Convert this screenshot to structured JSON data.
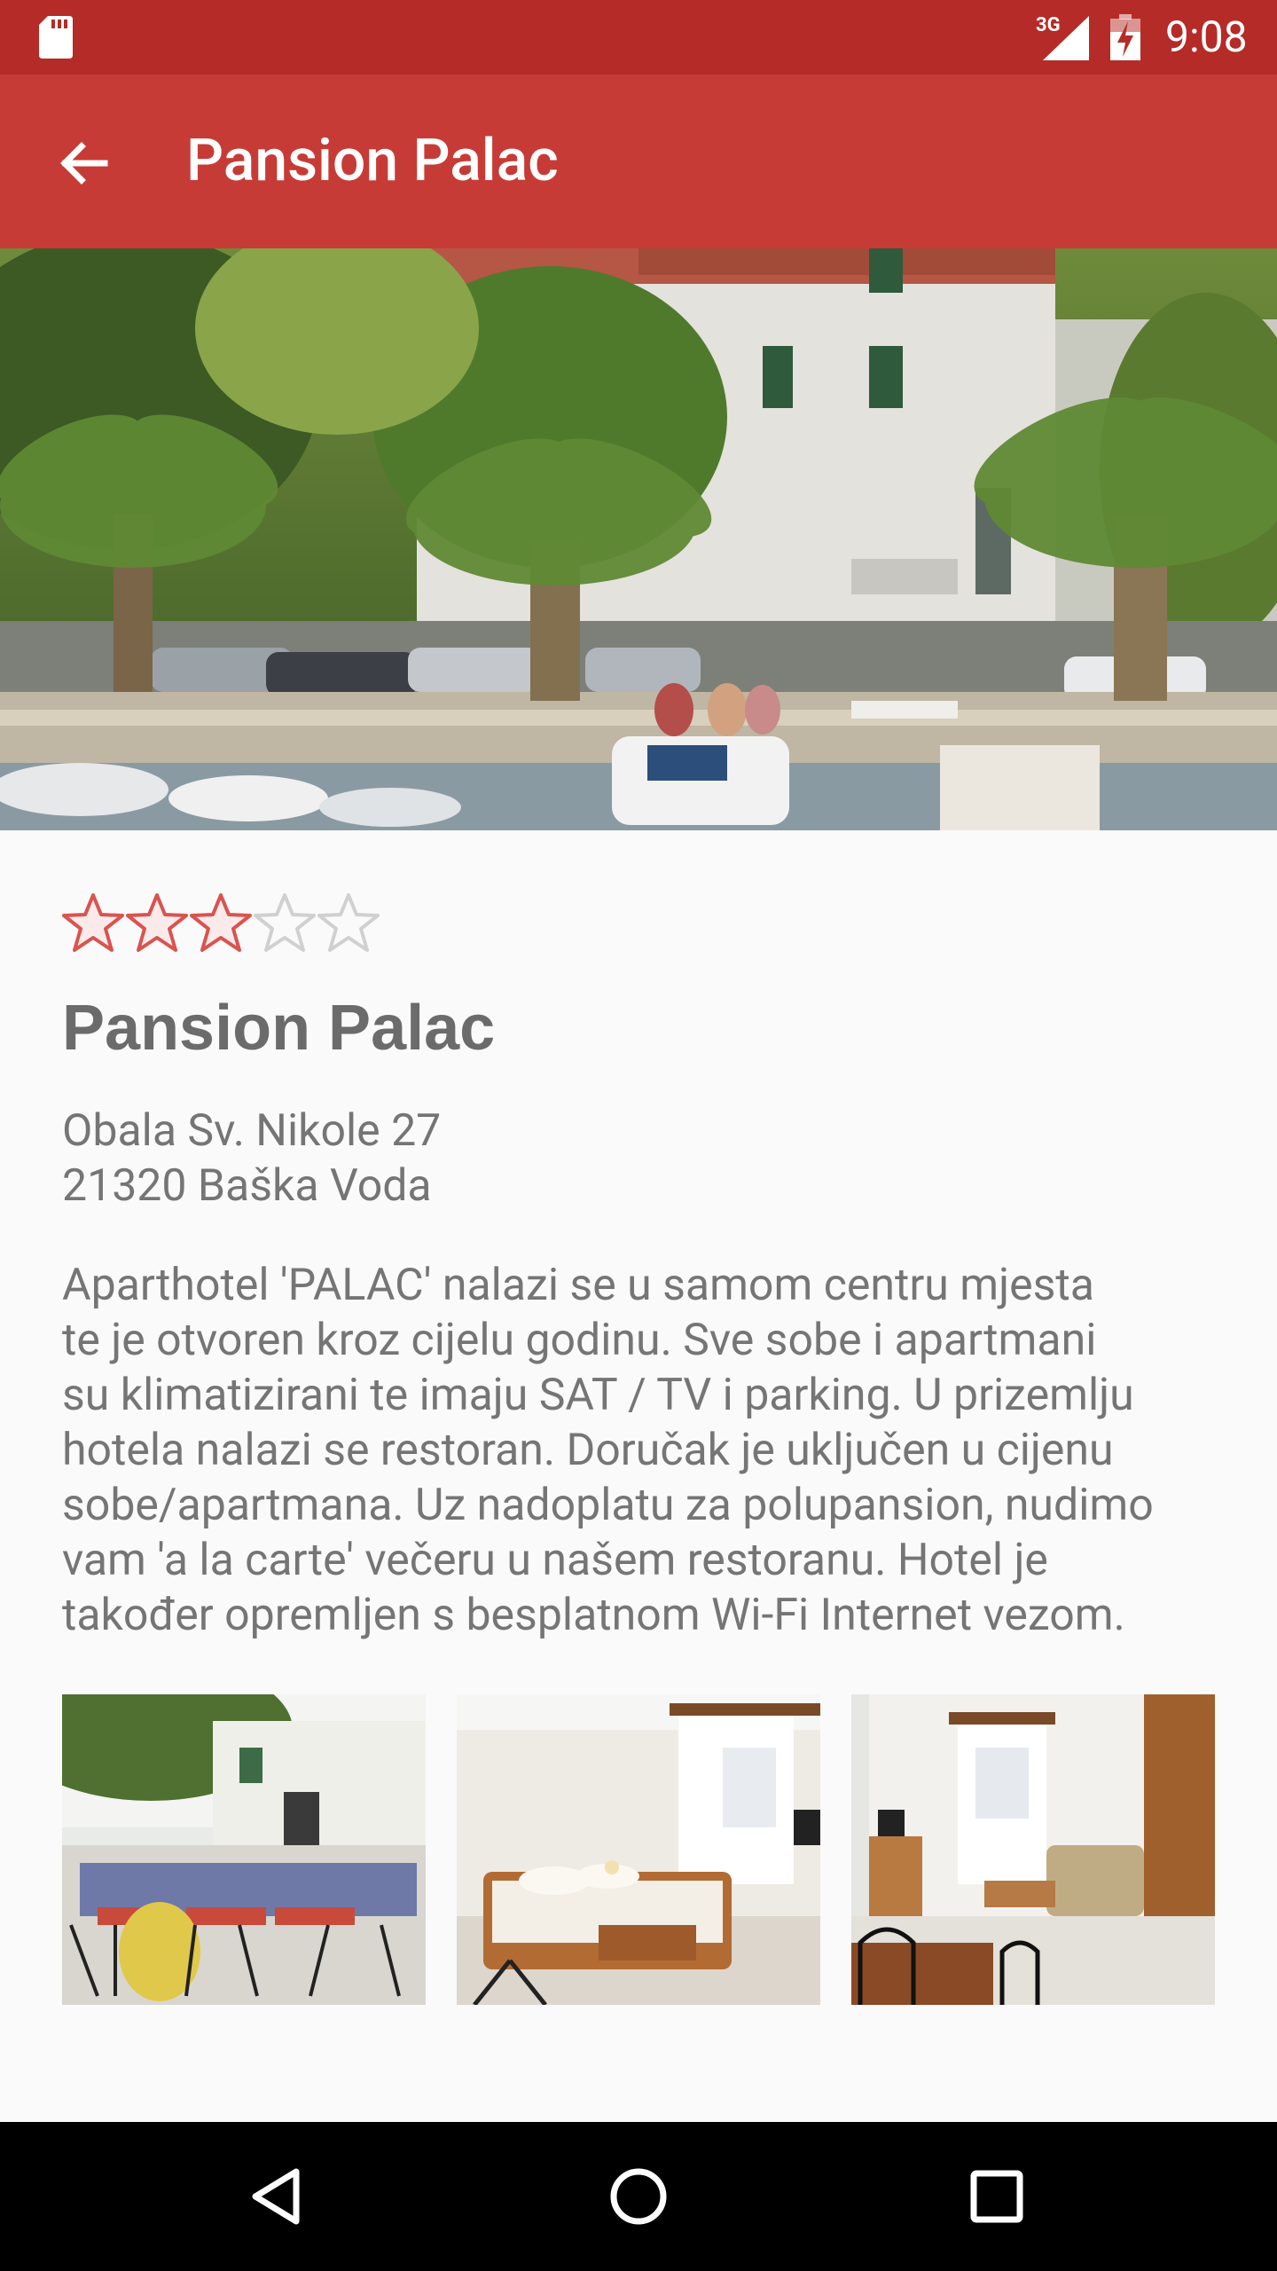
{
  "status_bar": {
    "network_type": "3G",
    "time": "9:08",
    "icons": [
      "sd-card-icon",
      "signal-icon",
      "battery-charging-icon"
    ]
  },
  "app_bar": {
    "title": "Pansion Palac",
    "back_icon": "arrow-back-icon"
  },
  "hotel": {
    "rating": 3,
    "max_rating": 5,
    "name": "Pansion Palac",
    "address_line1": "Obala Sv. Nikole 27",
    "address_line2": "21320 Baška Voda",
    "description_lines": [
      "Aparthotel 'PALAC' nalazi se u samom centru mjesta",
      "te je otvoren kroz cijelu godinu. Sve sobe i apartmani",
      "su klimatizirani te imaju SAT / TV i parking. U prizemlju",
      "hotela nalazi se restoran. Doručak je uključen u cijenu",
      "sobe/apartmana. Uz nadoplatu za polupansion, nudimo",
      "vam 'a la carte' večeru u našem restoranu. Hotel je",
      "također opremljen s besplatnom Wi-Fi Internet vezom."
    ]
  },
  "gallery": [
    {
      "label": "terrace-photo"
    },
    {
      "label": "bedroom-photo"
    },
    {
      "label": "apartment-living-room-photo"
    }
  ],
  "nav_bar": {
    "icons": [
      "back-triangle-icon",
      "home-circle-icon",
      "recents-square-icon"
    ]
  },
  "colors": {
    "status_bar": "#b52b27",
    "app_bar": "#c73b36",
    "star_filled": "#d9534f",
    "star_empty": "#d0d0d0",
    "text_primary": "#6b6b6b",
    "text_secondary": "#757575"
  }
}
